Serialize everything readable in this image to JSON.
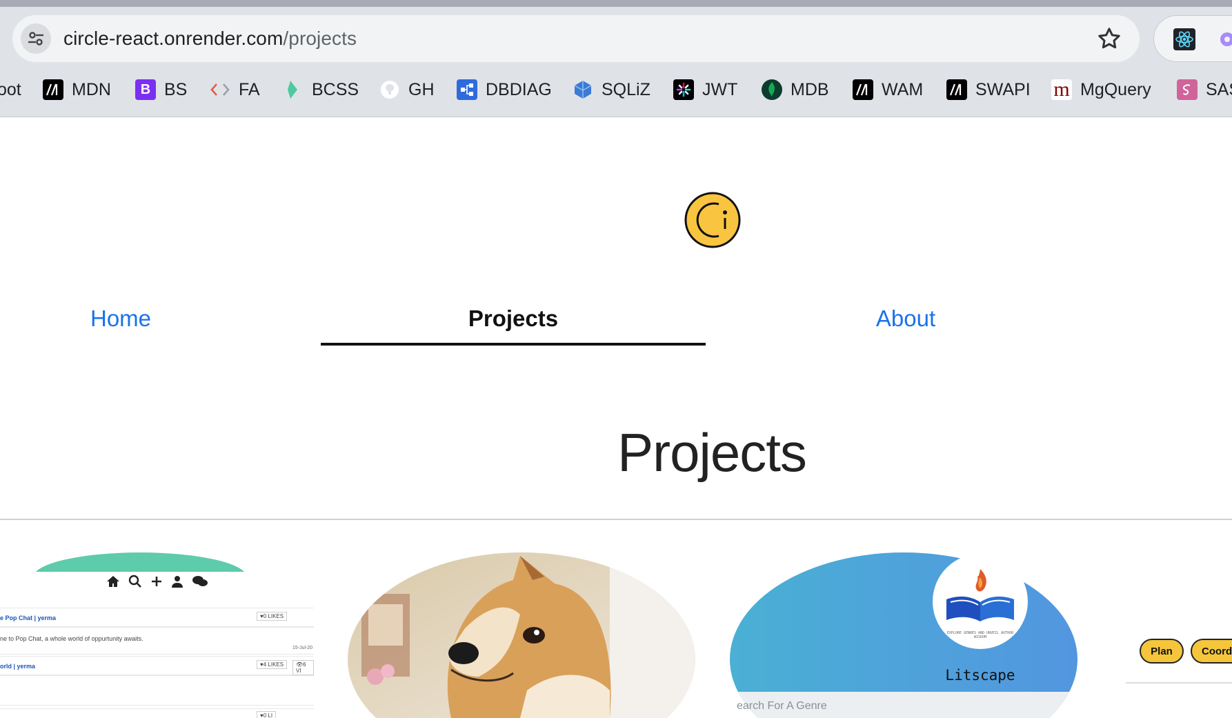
{
  "browser": {
    "url_host": "circle-react.onrender.com",
    "url_path": "/projects",
    "bookmarks": [
      {
        "label": "oot",
        "icon": "cut-off-icon",
        "color": "#dfe3e8"
      },
      {
        "label": "MDN",
        "icon": "mdn-icon",
        "color": "#000000"
      },
      {
        "label": "BS",
        "icon": "bootstrap-icon",
        "color": "#7b2ff2"
      },
      {
        "label": "FA",
        "icon": "code-brackets-icon",
        "color": "#e05d44"
      },
      {
        "label": "BCSS",
        "icon": "bootstrap-css-icon",
        "color": "#4ec9a0"
      },
      {
        "label": "GH",
        "icon": "github-icon",
        "color": "#ffffff"
      },
      {
        "label": "DBDIAG",
        "icon": "dbdiagram-icon",
        "color": "#2f6bdc"
      },
      {
        "label": "SQLiZ",
        "icon": "sqlizer-icon",
        "color": "#3b7bd6"
      },
      {
        "label": "JWT",
        "icon": "jwt-icon",
        "color": "#000000"
      },
      {
        "label": "MDB",
        "icon": "mongodb-icon",
        "color": "#0d3b2e"
      },
      {
        "label": "WAM",
        "icon": "mdn-icon",
        "color": "#000000"
      },
      {
        "label": "SWAPI",
        "icon": "mdn-icon",
        "color": "#000000"
      },
      {
        "label": "MgQuery",
        "icon": "mongoose-icon",
        "color": "#880000"
      },
      {
        "label": "SAS",
        "icon": "sass-icon",
        "color": "#cf649a"
      }
    ]
  },
  "nav": {
    "home": "Home",
    "projects": "Projects",
    "about": "About"
  },
  "main": {
    "title": "Projects"
  },
  "cards": {
    "popchat": {
      "row1_title": "e Pop Chat | yerma",
      "row1_likes": "0 LIKES",
      "row1_text": "ne to Pop Chat, a whole world of oppurtunity awaits.",
      "row1_date": "15-Jul-20",
      "row2_title": "orld | yerma",
      "row2_likes": "4 LIKES",
      "row2_views": "6 VI",
      "row3_likes": "0 LI"
    },
    "litscape": {
      "name": "Litscape",
      "search_placeholder": "earch For A Genre",
      "logo_tagline": "EXPLORE GENRES AND UNVEIL AUTHOR WISDOM"
    },
    "planner": {
      "chip1": "Plan",
      "chip2": "Coordi"
    }
  }
}
